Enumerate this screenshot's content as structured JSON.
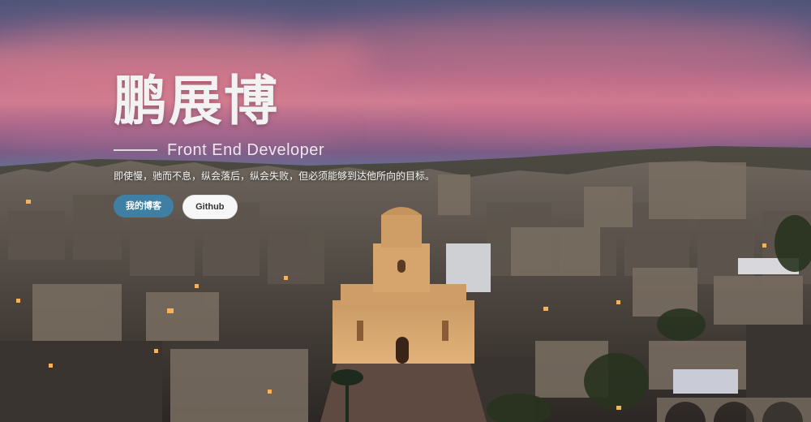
{
  "hero": {
    "name": "鹏展博",
    "role": "Front End Developer",
    "motto": "即使慢，驰而不息，纵会落后，纵会失败，但必须能够到达他所向的目标。",
    "buttons": {
      "blog_label": "我的博客",
      "github_label": "Github"
    },
    "colors": {
      "blog_button": "#3f7fa4",
      "github_button": "#f7f7f7",
      "title_text": "#f2f2f2"
    }
  }
}
